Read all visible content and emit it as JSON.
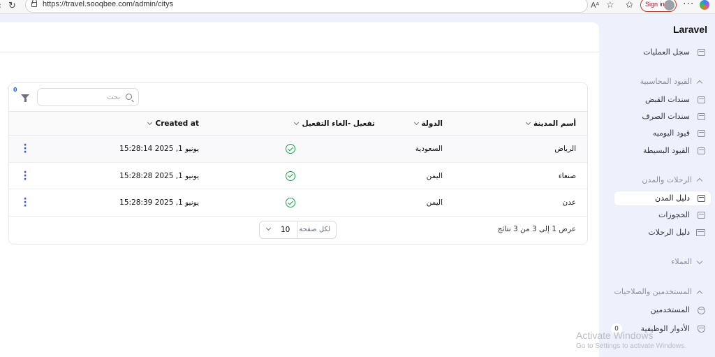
{
  "browser": {
    "url": "https://travel.sooqbee.com/admin/citys",
    "sign_in": "Sign in",
    "read_aloud": "Aᴬ"
  },
  "sidebar": {
    "brand": "Laravel",
    "items": [
      {
        "label": "سجل العمليات"
      },
      {
        "label": "سندات القبض"
      },
      {
        "label": "سندات الصرف"
      },
      {
        "label": "قيود اليوميه"
      },
      {
        "label": "القيود البسيطة"
      },
      {
        "label": "دليل المدن"
      },
      {
        "label": "الحجوزات"
      },
      {
        "label": "دليل الرحلات"
      },
      {
        "label": "المستخدمين"
      },
      {
        "label": "الأدوار الوظيفية",
        "badge": "0"
      }
    ],
    "groups": {
      "accounting": "القيود المحاسبية",
      "trips": "الرحلات والمدن",
      "customers": "العملاء",
      "users": "المستخدمين والصلاحيات"
    }
  },
  "toolbar": {
    "filter_count": "0",
    "search_placeholder": "بحث"
  },
  "table": {
    "columns": {
      "name": "أسم المدينة",
      "country": "الدولة",
      "activation": "تفعيل -الغاء التفعيل",
      "created": "Created at"
    },
    "rows": [
      {
        "name": "الرياض",
        "country": "السعودية",
        "created": "يونيو 1, 2025 15:28:14"
      },
      {
        "name": "صنعاء",
        "country": "اليمن",
        "created": "يونيو 1, 2025 15:28:28"
      },
      {
        "name": "عدن",
        "country": "اليمن",
        "created": "يونيو 1, 2025 15:28:39"
      }
    ]
  },
  "pagination": {
    "summary": "عرض 1 إلى 3 من 3 نتائج",
    "per_page_label": "لكل صفحة",
    "per_page_value": "10"
  },
  "watermark": {
    "line1": "Activate Windows",
    "line2": "Go to Settings to activate Windows."
  },
  "colors": {
    "accent_check": "#16a34a",
    "action_dots": "#3b5bdb",
    "sidebar_bg": "#eef1fb"
  }
}
